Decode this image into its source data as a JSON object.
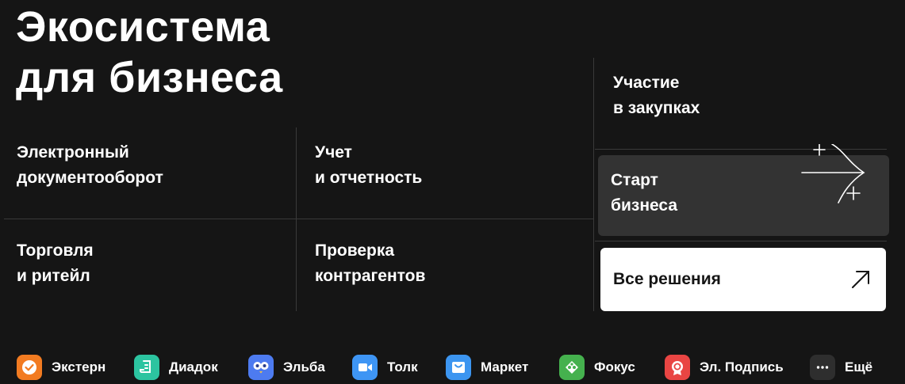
{
  "header": {
    "title": "Экосистема\nдля бизнеса"
  },
  "grid": {
    "edo": "Электронный\nдокументооборот",
    "accounting": "Учет\nи отчетность",
    "trade": "Торговля\nи ритейл",
    "check": "Проверка\nконтрагентов",
    "procurement": "Участие\nв закупках",
    "start": "Старт\nбизнеса",
    "all_solutions": "Все решения"
  },
  "products": [
    {
      "label": "Экстерн",
      "icon": "check-icon",
      "color": "#F27B21"
    },
    {
      "label": "Диадок",
      "icon": "document-icon",
      "color": "#2CC4A0"
    },
    {
      "label": "Эльба",
      "icon": "owl-icon",
      "color": "#4D7BF0"
    },
    {
      "label": "Толк",
      "icon": "video-camera-icon",
      "color": "#3E95F4"
    },
    {
      "label": "Маркет",
      "icon": "shopping-bag-icon",
      "color": "#3C95F0"
    },
    {
      "label": "Фокус",
      "icon": "network-icon",
      "color": "#45B14E"
    },
    {
      "label": "Эл. Подпись",
      "icon": "certificate-icon",
      "color": "#E94543"
    },
    {
      "label": "Ещё",
      "icon": "more-dots-icon",
      "color": "#2E2E2E"
    }
  ]
}
